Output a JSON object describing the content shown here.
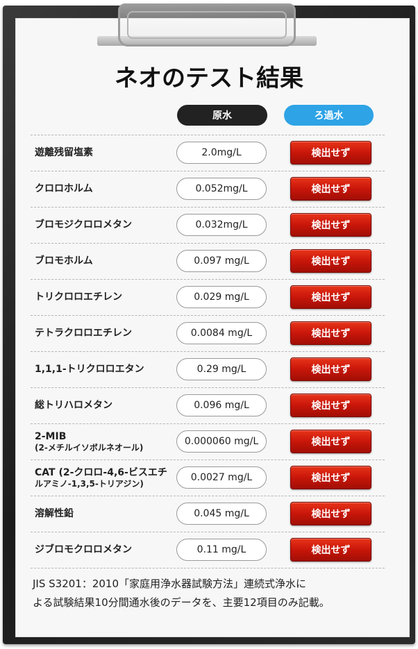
{
  "title": "ネオのテスト結果",
  "columns": {
    "raw": "原水",
    "filtered": "ろ過水"
  },
  "rows": [
    {
      "name": "遊離残留塩素",
      "sub": "",
      "value": "2.0mg/L",
      "result": "検出せず"
    },
    {
      "name": "クロロホルム",
      "sub": "",
      "value": "0.052mg/L",
      "result": "検出せず"
    },
    {
      "name": "ブロモジクロロメタン",
      "sub": "",
      "value": "0.032mg/L",
      "result": "検出せず"
    },
    {
      "name": "ブロモホルム",
      "sub": "",
      "value": "0.097 mg/L",
      "result": "検出せず"
    },
    {
      "name": "トリクロロエチレン",
      "sub": "",
      "value": "0.029 mg/L",
      "result": "検出せず"
    },
    {
      "name": "テトラクロロエチレン",
      "sub": "",
      "value": "0.0084 mg/L",
      "result": "検出せず"
    },
    {
      "name": "1,1,1-トリクロロエタン",
      "sub": "",
      "value": "0.29 mg/L",
      "result": "検出せず"
    },
    {
      "name": "総トリハロメタン",
      "sub": "",
      "value": "0.096 mg/L",
      "result": "検出せず"
    },
    {
      "name": "2-MIB",
      "sub": "(2-メチルイソボルネオール)",
      "value": "0.000060 mg/L",
      "result": "検出せず"
    },
    {
      "name": "CAT (2-クロロ-4,6-ビスエチ",
      "sub": "ルアミノ-1,3,5-トリアジン)",
      "value": "0.0027 mg/L",
      "result": "検出せず"
    },
    {
      "name": "溶解性鉛",
      "sub": "",
      "value": "0.045 mg/L",
      "result": "検出せず"
    },
    {
      "name": "ジブロモクロロメタン",
      "sub": "",
      "value": "0.11 mg/L",
      "result": "検出せず"
    }
  ],
  "footnote": {
    "line1": "JIS S3201：2010「家庭用浄水器試験方法」連続式浄水に",
    "line2": "よる試験結果10分間通水後のデータを、主要12項目のみ記載。"
  }
}
